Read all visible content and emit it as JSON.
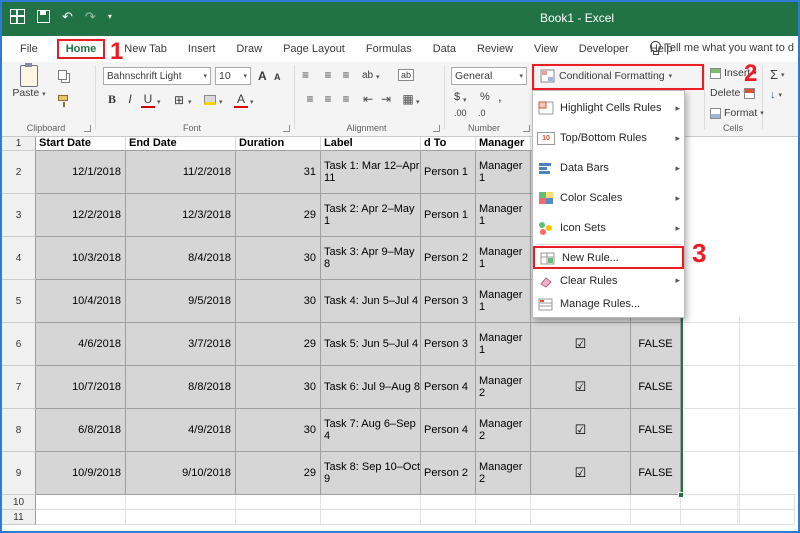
{
  "colors": {
    "excel_green": "#217346",
    "annotation_red": "#ec1c24",
    "selection_fill": "#d6d6d6"
  },
  "titlebar": {
    "title": "Book1 - Excel"
  },
  "icons": {
    "undo": "↶",
    "redo": "↷",
    "dropdown": "▾",
    "submenu": "▸",
    "sum": "Σ",
    "checkbox_checked": "☑",
    "align_lines": "≡",
    "borders": "⊞",
    "merge": "▦",
    "indent_left": "⇤",
    "indent_right": "⇥",
    "orientation": "ab",
    "wrap": "ab",
    "fill_arrow": "↓",
    "ten": "10"
  },
  "tabs": {
    "file": "File",
    "home": "Home",
    "new_tab": "New Tab",
    "insert": "Insert",
    "draw": "Draw",
    "page_layout": "Page Layout",
    "formulas": "Formulas",
    "data": "Data",
    "review": "Review",
    "view": "View",
    "developer": "Developer",
    "help": "Help",
    "tell_me": "Tell me what you want to d"
  },
  "ribbon": {
    "clipboard": {
      "paste": "Paste",
      "label": "Clipboard"
    },
    "font": {
      "name": "Bahnschrift Light",
      "size": "10",
      "bold": "B",
      "italic": "I",
      "underline": "U",
      "grow": "A",
      "shrink": "A",
      "label": "Font"
    },
    "alignment": {
      "label": "Alignment"
    },
    "number": {
      "format": "General",
      "currency": "$",
      "percent": "%",
      "comma": ",",
      "dec_inc": ".00",
      "dec_dec": ".0",
      "label": "Number"
    },
    "styles": {
      "conditional_formatting": "Conditional Formatting"
    },
    "cells": {
      "insert": "Insert",
      "del": "Delete",
      "format": "Format",
      "label": "Cells"
    }
  },
  "menu": {
    "items": [
      {
        "label": "Highlight Cells Rules"
      },
      {
        "label": "Top/Bottom Rules"
      },
      {
        "label": "Data Bars"
      },
      {
        "label": "Color Scales"
      },
      {
        "label": "Icon Sets"
      },
      {
        "label": "New Rule..."
      },
      {
        "label": "Clear Rules"
      },
      {
        "label": "Manage Rules..."
      }
    ]
  },
  "annotations": {
    "n1": "1",
    "n2": "2",
    "n3": "3"
  },
  "sheet": {
    "row_numbers": [
      "1",
      "2",
      "3",
      "4",
      "5",
      "6",
      "7",
      "8",
      "9",
      "10",
      "11"
    ],
    "headers": [
      "Start Date",
      "End Date",
      "Duration",
      "Label",
      "d To",
      "Manager"
    ],
    "rows": [
      [
        "12/1/2018",
        "11/2/2018",
        "31",
        "Task 1: Mar 12–Apr 11",
        "Person 1",
        "Manager 1",
        "",
        ""
      ],
      [
        "12/2/2018",
        "12/3/2018",
        "29",
        "Task 2: Apr 2–May 1",
        "Person 1",
        "Manager 1",
        "",
        ""
      ],
      [
        "10/3/2018",
        "8/4/2018",
        "30",
        "Task 3: Apr 9–May 8",
        "Person 2",
        "Manager 1",
        "",
        ""
      ],
      [
        "10/4/2018",
        "9/5/2018",
        "30",
        "Task 4: Jun 5–Jul 4",
        "Person 3",
        "Manager 1",
        "",
        ""
      ],
      [
        "4/6/2018",
        "3/7/2018",
        "29",
        "Task 5: Jun 5–Jul 4",
        "Person 3",
        "Manager 1",
        "☑",
        "FALSE"
      ],
      [
        "10/7/2018",
        "8/8/2018",
        "30",
        "Task 6: Jul 9–Aug 8",
        "Person 4",
        "Manager 2",
        "☑",
        "FALSE"
      ],
      [
        "6/8/2018",
        "4/9/2018",
        "30",
        "Task 7: Aug 6–Sep 4",
        "Person 4",
        "Manager 2",
        "☑",
        "FALSE"
      ],
      [
        "10/9/2018",
        "9/10/2018",
        "29",
        "Task 8: Sep 10–Oct 9",
        "Person 2",
        "Manager 2",
        "☑",
        "FALSE"
      ]
    ]
  }
}
